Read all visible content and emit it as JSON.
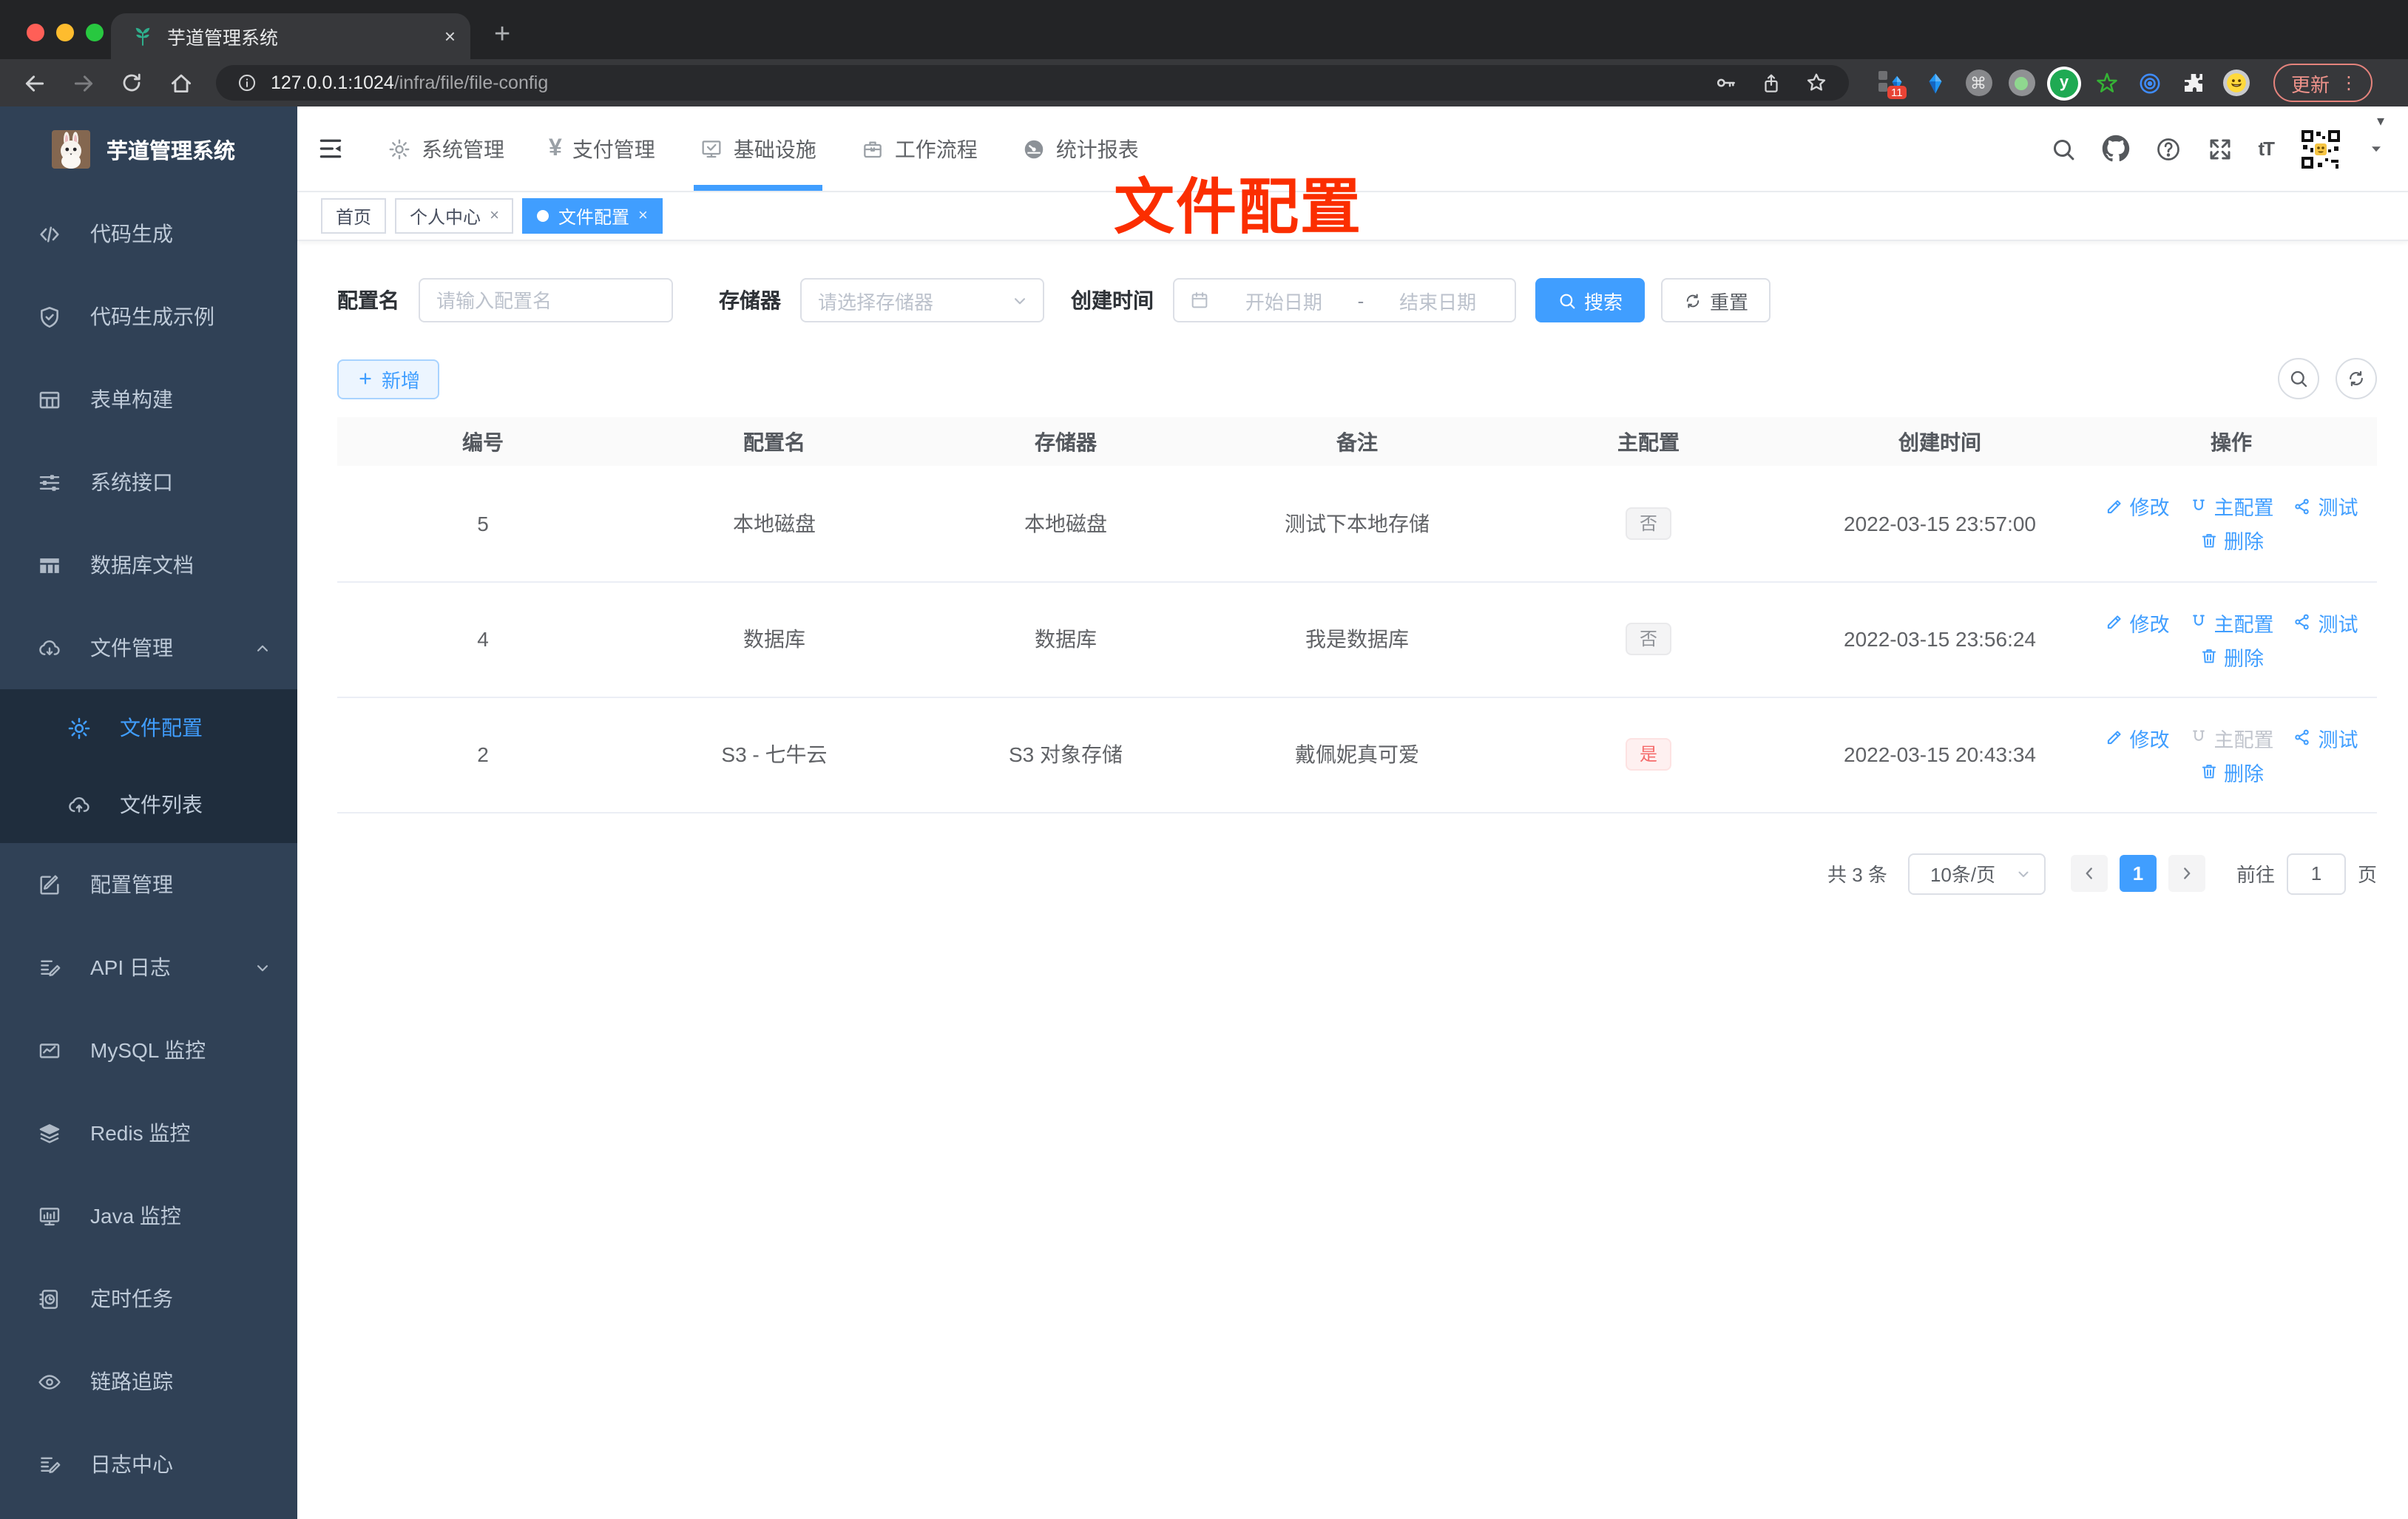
{
  "glyphs": {
    "close": "×",
    "plus": "+",
    "yen": "¥",
    "cmd": "⌘",
    "font_size": "tT",
    "y_letter": "y",
    "more": "⋮",
    "caret_down": "▾",
    "dash": "-"
  },
  "browser": {
    "tab_title": "芋道管理系统",
    "url_host": "127.0.0.1:1024",
    "url_path": "/infra/file/file-config",
    "ext_badge": "11",
    "update_label": "更新"
  },
  "sidebar": {
    "title": "芋道管理系统",
    "items": [
      {
        "icon": "code-icon",
        "label": "代码生成"
      },
      {
        "icon": "shield-check-icon",
        "label": "代码生成示例"
      },
      {
        "icon": "form-grid-icon",
        "label": "表单构建"
      },
      {
        "icon": "sliders-icon",
        "label": "系统接口"
      },
      {
        "icon": "db-table-icon",
        "label": "数据库文档"
      },
      {
        "icon": "cloud-download-icon",
        "label": "文件管理"
      },
      {
        "icon": "gear-icon",
        "label": "文件配置"
      },
      {
        "icon": "cloud-upload-icon",
        "label": "文件列表"
      },
      {
        "icon": "edit-square-icon",
        "label": "配置管理"
      },
      {
        "icon": "doc-edit-icon",
        "label": "API 日志"
      },
      {
        "icon": "chart-icon",
        "label": "MySQL 监控"
      },
      {
        "icon": "layers-icon",
        "label": "Redis 监控"
      },
      {
        "icon": "monitor-icon",
        "label": "Java 监控"
      },
      {
        "icon": "schedule-icon",
        "label": "定时任务"
      },
      {
        "icon": "eye-icon",
        "label": "链路追踪"
      },
      {
        "icon": "doc-edit-icon",
        "label": "日志中心"
      }
    ]
  },
  "topnav": {
    "items": [
      {
        "label": "系统管理"
      },
      {
        "label": "支付管理"
      },
      {
        "label": "基础设施",
        "active": true
      },
      {
        "label": "工作流程"
      },
      {
        "label": "统计报表"
      }
    ]
  },
  "tags": [
    {
      "label": "首页"
    },
    {
      "label": "个人中心",
      "closable": true
    },
    {
      "label": "文件配置",
      "active": true,
      "closable": true
    }
  ],
  "annotation": {
    "text": "文件配置",
    "color": "#fb2e00"
  },
  "filters": {
    "config_name_label": "配置名",
    "config_name_placeholder": "请输入配置名",
    "storage_label": "存储器",
    "storage_placeholder": "请选择存储器",
    "create_time_label": "创建时间",
    "date_start_placeholder": "开始日期",
    "date_separator": "-",
    "date_end_placeholder": "结束日期",
    "search_label": "搜索",
    "reset_label": "重置"
  },
  "toolbar": {
    "add_label": "新增"
  },
  "table": {
    "headers": [
      "编号",
      "配置名",
      "存储器",
      "备注",
      "主配置",
      "创建时间",
      "操作"
    ],
    "actions": {
      "edit": "修改",
      "master": "主配置",
      "test": "测试",
      "delete": "删除"
    },
    "rows": [
      {
        "id": "5",
        "name": "本地磁盘",
        "storage": "本地磁盘",
        "remark": "测试下本地存储",
        "master": "否",
        "created": "2022-03-15 23:57:00"
      },
      {
        "id": "4",
        "name": "数据库",
        "storage": "数据库",
        "remark": "我是数据库",
        "master": "否",
        "created": "2022-03-15 23:56:24"
      },
      {
        "id": "2",
        "name": "S3 - 七牛云",
        "storage": "S3 对象存储",
        "remark": "戴佩妮真可爱",
        "master": "是",
        "created": "2022-03-15 20:43:34"
      }
    ]
  },
  "pagination": {
    "total": "共 3 条",
    "size": "10条/页",
    "page": "1",
    "goto_label": "前往",
    "goto_value": "1",
    "unit_label": "页"
  },
  "colors": {
    "primary": "#409eff",
    "danger": "#f56c6c",
    "annotation": "#fb2e00",
    "sidebar": "#304156",
    "submenu": "#1f2d3d"
  }
}
